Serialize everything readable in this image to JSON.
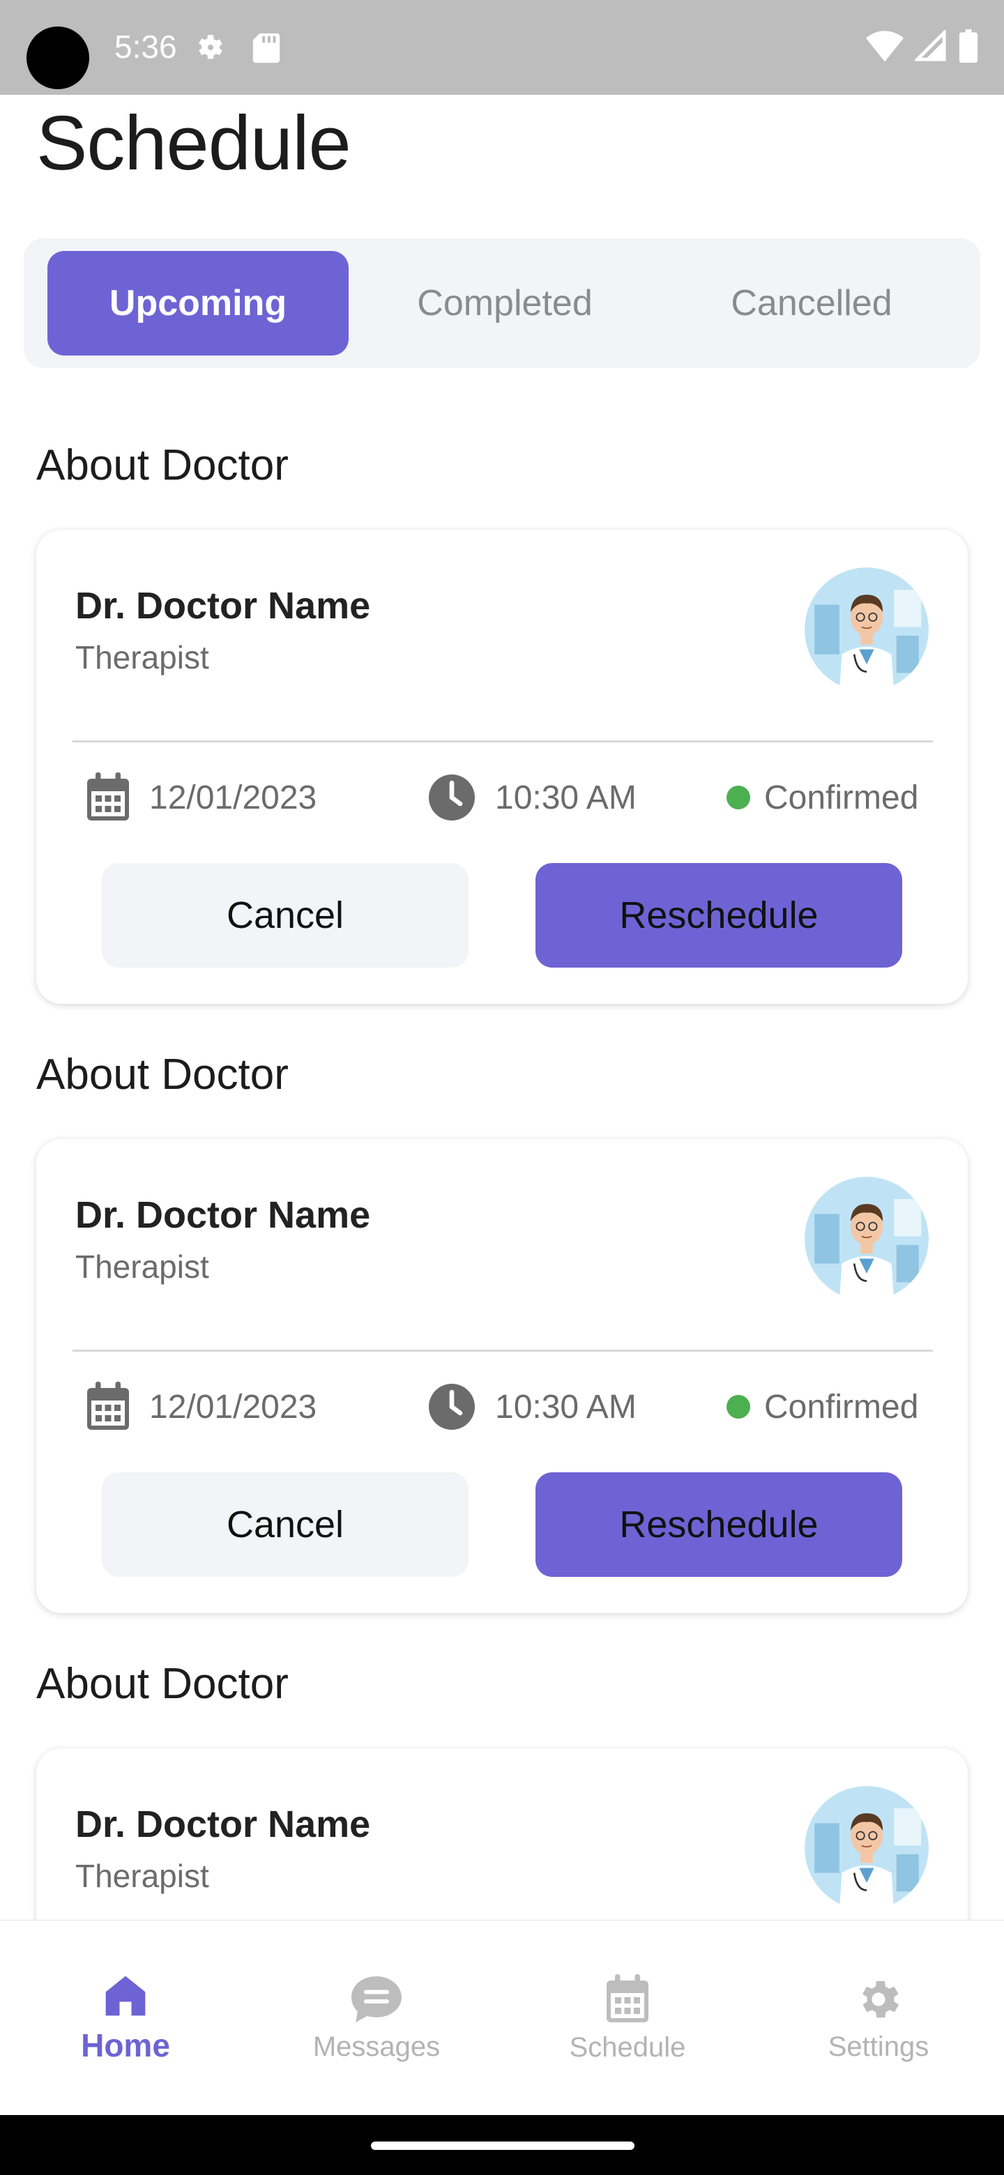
{
  "status_bar": {
    "time": "5:36"
  },
  "header": {
    "title": "Schedule"
  },
  "tabs": [
    {
      "label": "Upcoming",
      "active": true
    },
    {
      "label": "Completed",
      "active": false
    },
    {
      "label": "Cancelled",
      "active": false
    }
  ],
  "appointments": [
    {
      "section_title": "About Doctor",
      "doctor_name": "Dr. Doctor Name",
      "role": "Therapist",
      "date": "12/01/2023",
      "time": "10:30 AM",
      "status": "Confirmed",
      "cancel_label": "Cancel",
      "reschedule_label": "Reschedule"
    },
    {
      "section_title": "About Doctor",
      "doctor_name": "Dr. Doctor Name",
      "role": "Therapist",
      "date": "12/01/2023",
      "time": "10:30 AM",
      "status": "Confirmed",
      "cancel_label": "Cancel",
      "reschedule_label": "Reschedule"
    },
    {
      "section_title": "About Doctor",
      "doctor_name": "Dr. Doctor Name",
      "role": "Therapist"
    }
  ],
  "bottom_nav": [
    {
      "label": "Home",
      "icon": "home-icon",
      "active": true
    },
    {
      "label": "Messages",
      "icon": "chat-icon",
      "active": false
    },
    {
      "label": "Schedule",
      "icon": "calendar-icon",
      "active": false
    },
    {
      "label": "Settings",
      "icon": "gear-icon",
      "active": false
    }
  ],
  "colors": {
    "accent": "#6e63d4",
    "status_confirmed": "#4caf50",
    "tab_bg": "#f3f4f8",
    "muted_text": "#6b6b6b"
  }
}
